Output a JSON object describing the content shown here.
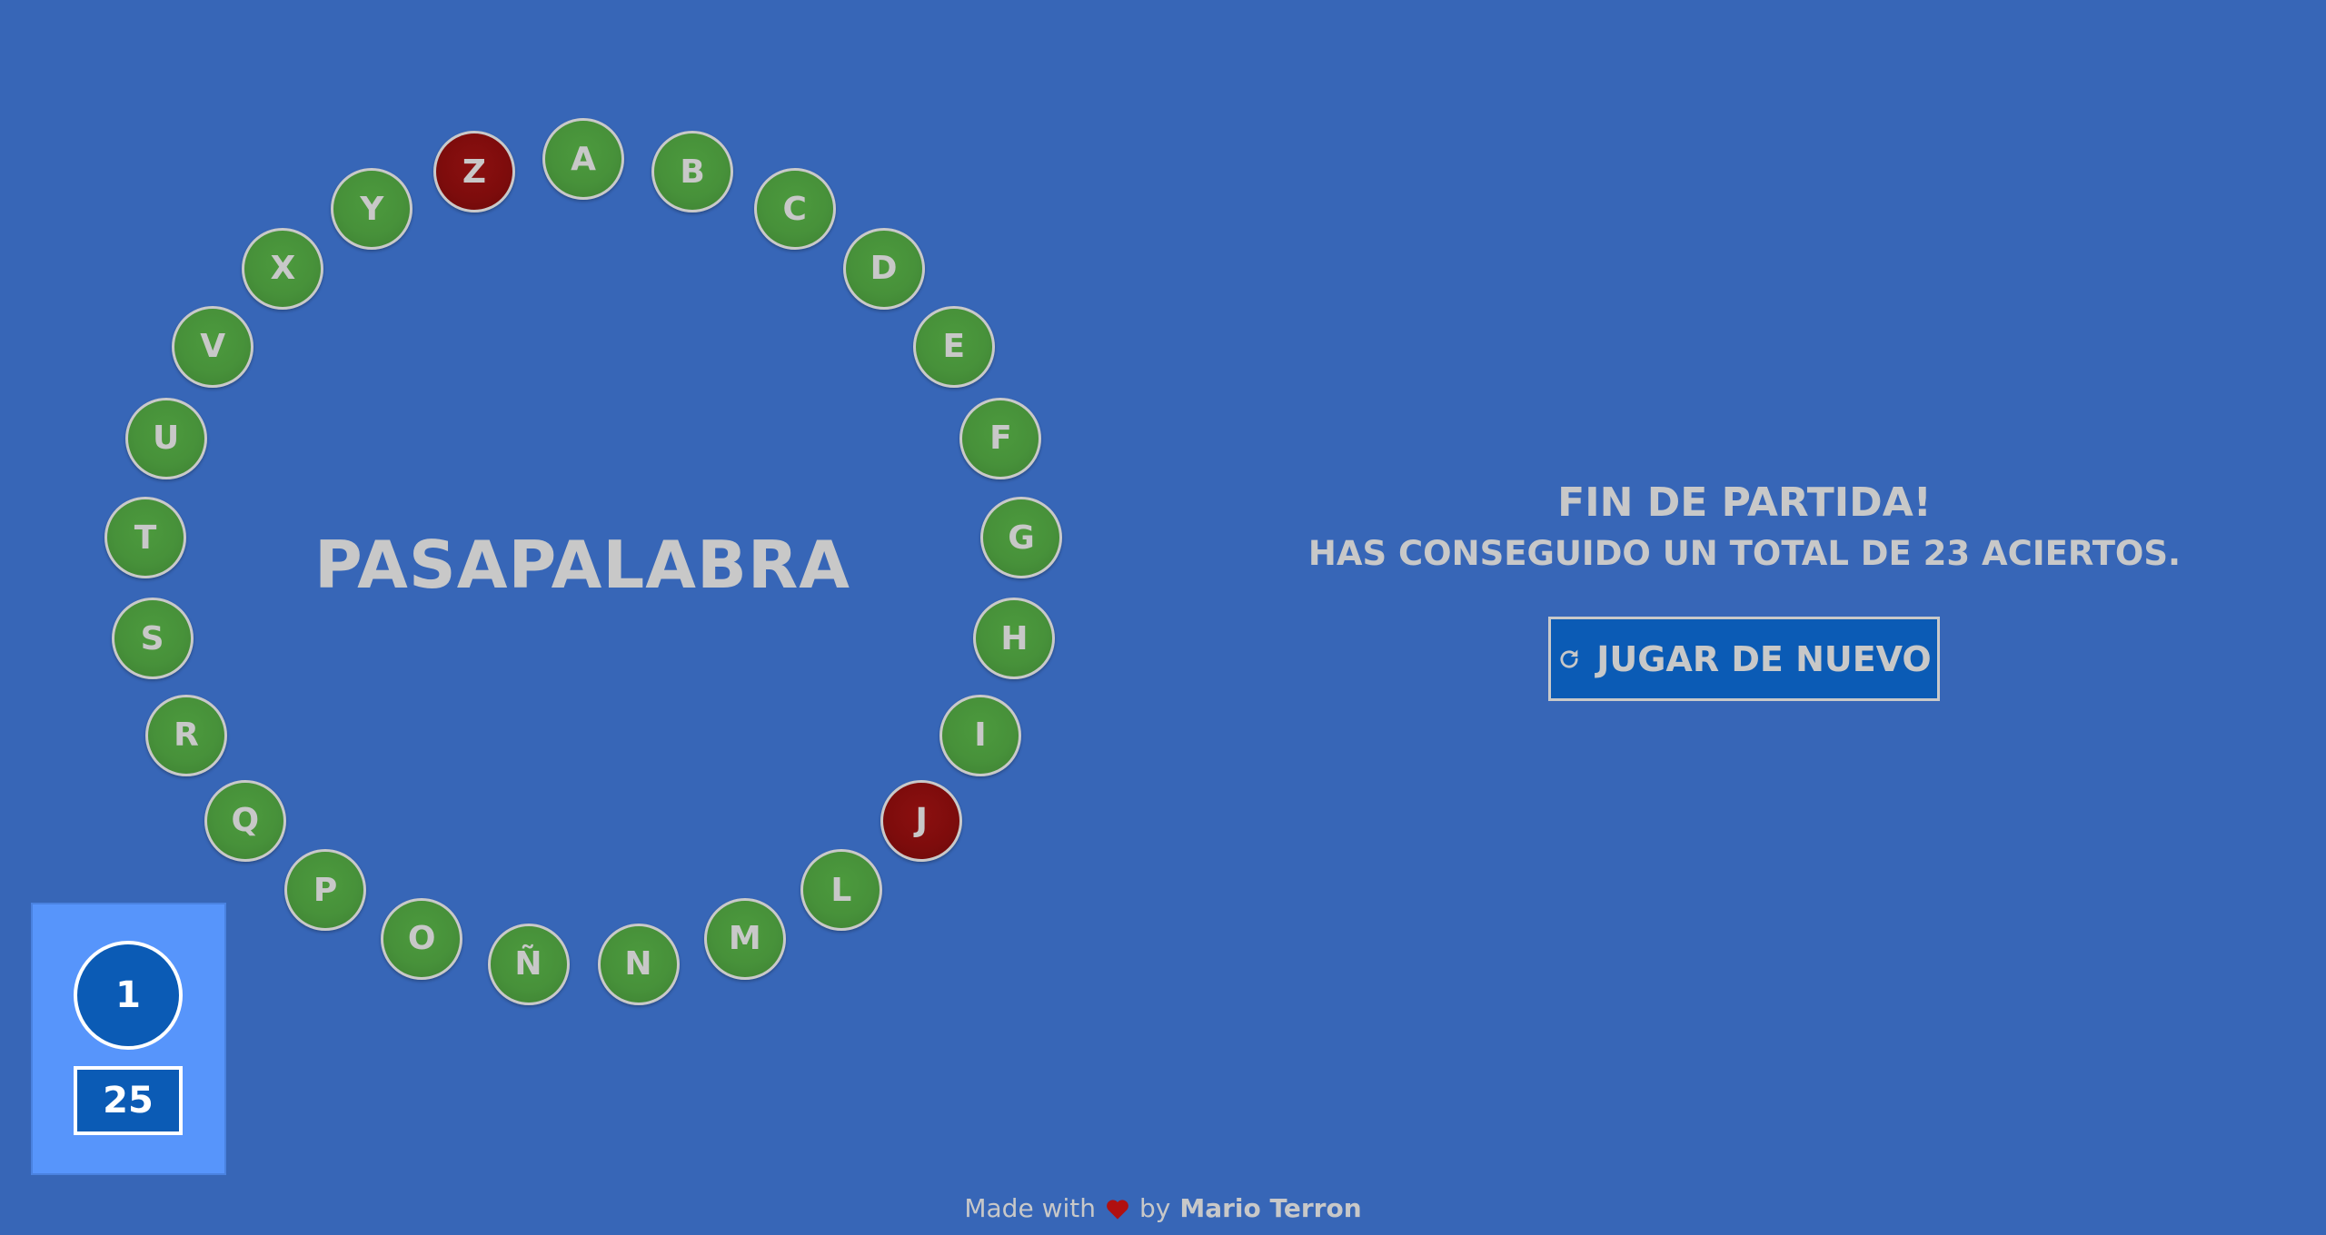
{
  "game": {
    "title": "PASAPALABRA",
    "letters": [
      {
        "letter": "A",
        "status": "correct"
      },
      {
        "letter": "B",
        "status": "correct"
      },
      {
        "letter": "C",
        "status": "correct"
      },
      {
        "letter": "D",
        "status": "correct"
      },
      {
        "letter": "E",
        "status": "correct"
      },
      {
        "letter": "F",
        "status": "correct"
      },
      {
        "letter": "G",
        "status": "correct"
      },
      {
        "letter": "H",
        "status": "correct"
      },
      {
        "letter": "I",
        "status": "correct"
      },
      {
        "letter": "J",
        "status": "wrong"
      },
      {
        "letter": "L",
        "status": "correct"
      },
      {
        "letter": "M",
        "status": "correct"
      },
      {
        "letter": "N",
        "status": "correct"
      },
      {
        "letter": "Ñ",
        "status": "correct"
      },
      {
        "letter": "O",
        "status": "correct"
      },
      {
        "letter": "P",
        "status": "correct"
      },
      {
        "letter": "Q",
        "status": "correct"
      },
      {
        "letter": "R",
        "status": "correct"
      },
      {
        "letter": "S",
        "status": "correct"
      },
      {
        "letter": "T",
        "status": "correct"
      },
      {
        "letter": "U",
        "status": "correct"
      },
      {
        "letter": "V",
        "status": "correct"
      },
      {
        "letter": "X",
        "status": "correct"
      },
      {
        "letter": "Y",
        "status": "correct"
      },
      {
        "letter": "Z",
        "status": "wrong"
      }
    ]
  },
  "result": {
    "headline": "FIN DE PARTIDA!",
    "summary": "HAS CONSEGUIDO UN TOTAL DE 23 ACIERTOS.",
    "replay_label": "JUGAR DE NUEVO",
    "replay_icon": "refresh-icon"
  },
  "score": {
    "circle_value": "1",
    "box_value": "25"
  },
  "footer": {
    "made_with": "Made with",
    "heart_icon": "heart-icon",
    "by": "by",
    "author": "Mario Terron"
  },
  "colors": {
    "background": "#3766b7",
    "correct": "#47913a",
    "wrong": "#7e0c0c",
    "button": "#0b5bb5",
    "score_panel": "#5795fb",
    "heart": "#b01010",
    "text": "#c8c8c8"
  }
}
